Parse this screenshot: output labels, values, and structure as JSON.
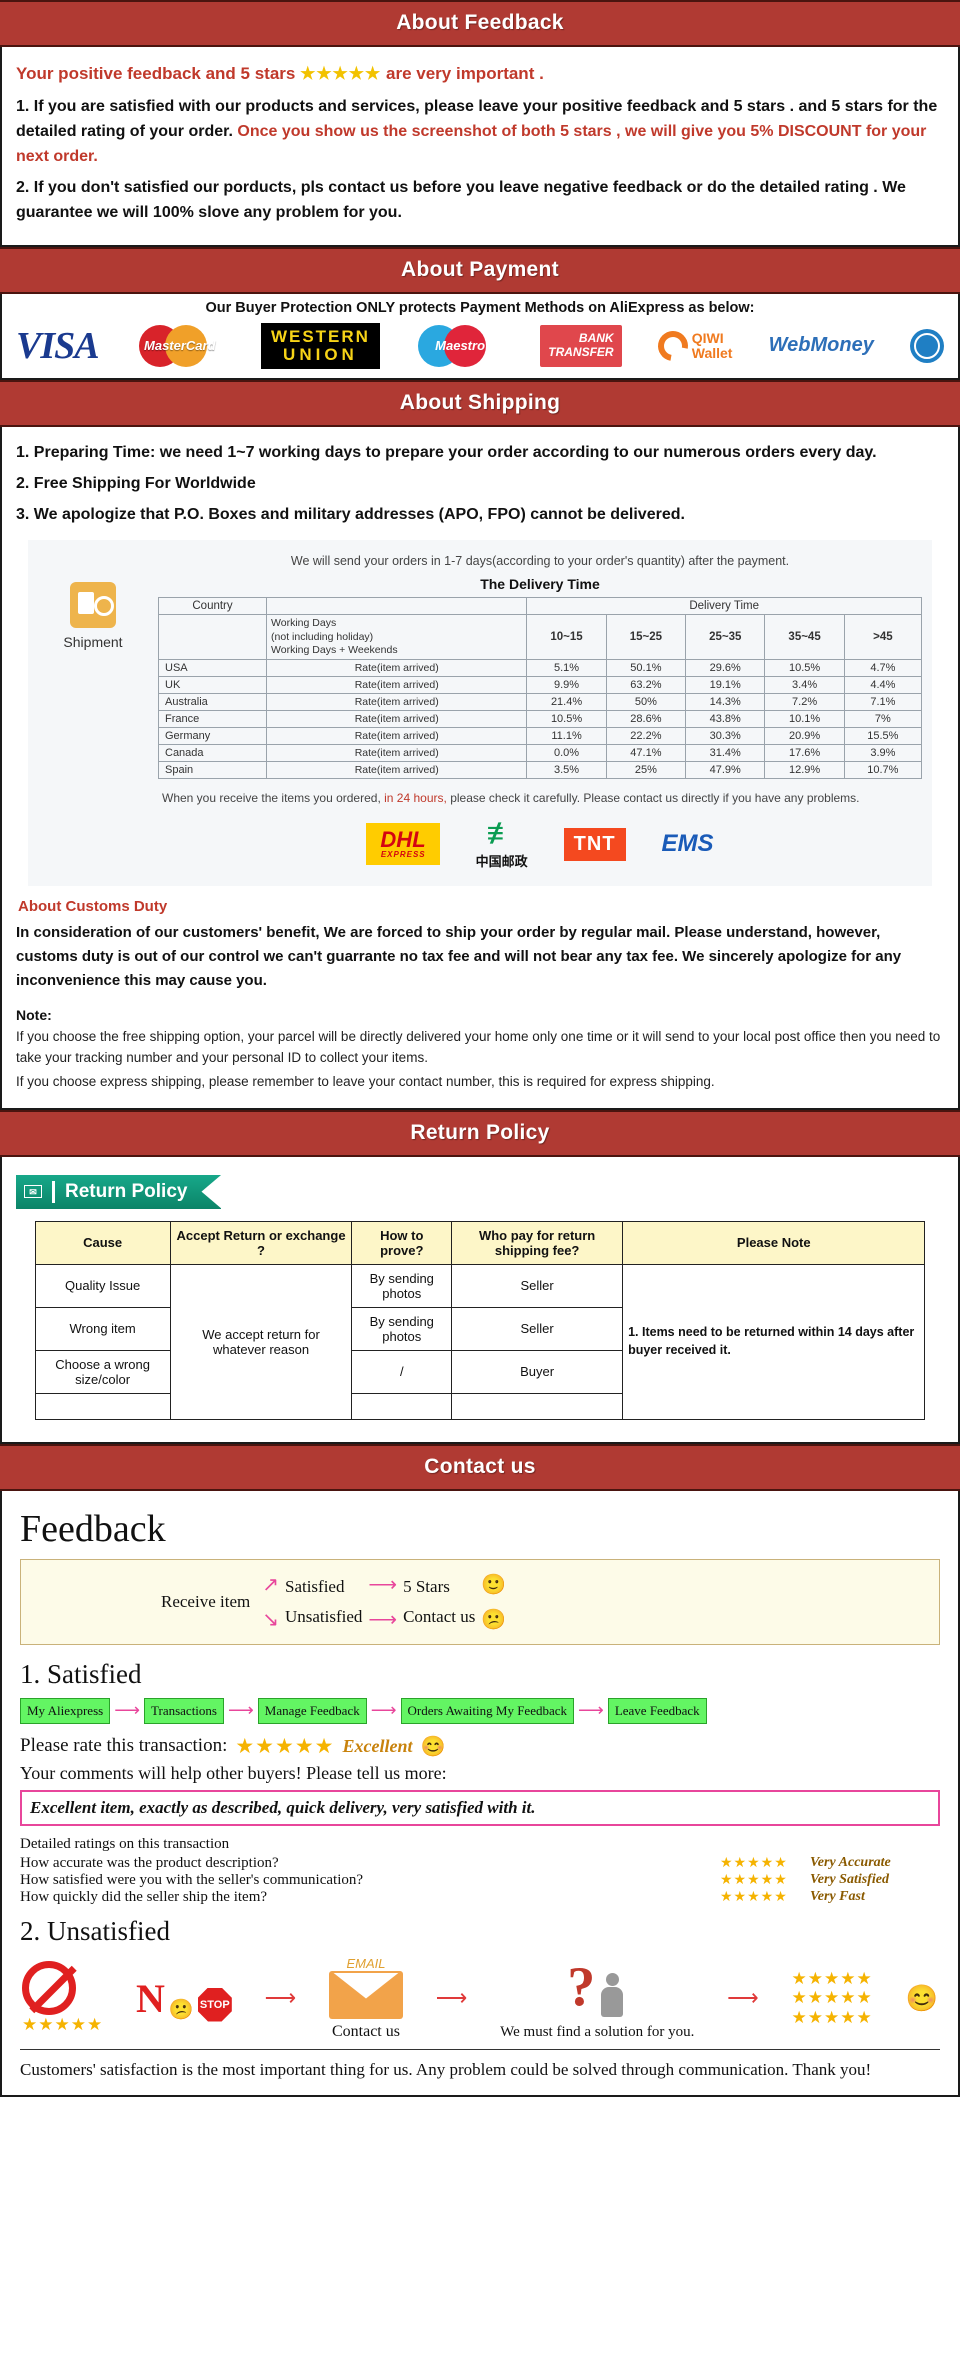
{
  "sections": {
    "feedback": {
      "banner": "About Feedback",
      "lead_before": "Your positive feedback and 5 stars",
      "lead_stars": "★★★★★",
      "lead_after": "are very important .",
      "p1_a": "1. If you are satisfied with our products and services, please leave your positive feedback and 5 stars . and 5 stars for the detailed rating of your order.",
      "p1_b": "Once you show us the screenshot of both 5 stars , we will give you 5% DISCOUNT for your next order.",
      "p2": "2. If you don't satisfied our porducts, pls contact us before you leave negative feedback or do the detailed rating . We guarantee we will 100% slove any problem for you."
    },
    "payment": {
      "banner": "About Payment",
      "note": "Our Buyer Protection ONLY protects Payment Methods on AliExpress as below:",
      "methods": [
        {
          "name": "VISA",
          "id": "visa-logo"
        },
        {
          "name": "MasterCard",
          "id": "mastercard-logo"
        },
        {
          "name": "WESTERN UNION",
          "line1": "WESTERN",
          "line2": "UNION",
          "id": "western-union-logo"
        },
        {
          "name": "Maestro",
          "id": "maestro-logo"
        },
        {
          "name": "BANK TRANSFER",
          "line1": "BANK",
          "line2": "TRANSFER",
          "id": "bank-transfer-logo"
        },
        {
          "name": "QIWI Wallet",
          "line1": "QIWI",
          "line2": "Wallet",
          "id": "qiwi-wallet-logo"
        },
        {
          "name": "WebMoney",
          "id": "webmoney-logo"
        }
      ]
    },
    "shipping": {
      "banner": "About Shipping",
      "items": [
        "1. Preparing Time: we need 1~7 working days to prepare your order according to our numerous orders every day.",
        "2. Free Shipping For Worldwide",
        "3. We apologize that P.O. Boxes and military addresses (APO, FPO) cannot be delivered."
      ],
      "ship_icon_label": "Shipment",
      "card_note": "We will send your orders in 1-7 days(according to your order's quantity) after the payment.",
      "check_note_a": "When you receive the items you ordered,",
      "check_note_red": "in 24 hours,",
      "check_note_b": "please check it carefully. Please contact us directly if you have any problems.",
      "carriers": [
        {
          "name": "DHL",
          "sub": "EXPRESS"
        },
        {
          "name": "China Post",
          "cn": "中国邮政"
        },
        {
          "name": "TNT"
        },
        {
          "name": "EMS"
        }
      ]
    },
    "customs": {
      "heading": "About Customs Duty",
      "body": "In consideration of our customers' benefit, We are forced to ship your order by regular mail. Please understand, however, customs duty is out of our control we can't guarrante no tax fee and will not bear any tax fee. We sincerely apologize for any inconvenience this may cause you.",
      "note_head": "Note:",
      "note1": "If you choose the free shipping option, your parcel will be directly delivered your home only one time or it will send to your local post office then you need to take your tracking number and your personal ID to collect your items.",
      "note2": "If you choose express shipping, please remember to leave your contact number, this is required for express shipping."
    },
    "return": {
      "banner": "Return Policy",
      "tab_label": "Return Policy",
      "note_cell": "1. Items need to be returned within 14 days after buyer received it."
    },
    "contact": {
      "banner": "Contact us",
      "feedback_title": "Feedback",
      "flow": {
        "receive": "Receive item",
        "satisfied": "Satisfied",
        "five_stars": "5 Stars",
        "unsatisfied": "Unsatisfied",
        "contact_us": "Contact us",
        "happy_face": "🙂",
        "sad_face": "😕"
      },
      "satisfied": {
        "heading": "1. Satisfied",
        "steps": [
          "My Aliexpress",
          "Transactions",
          "Manage Feedback",
          "Orders Awaiting My Feedback",
          "Leave Feedback"
        ],
        "rate_label": "Please rate this transaction:",
        "rate_stars": "★★★★★",
        "rate_word": "Excellent",
        "rate_emoji": "😊",
        "comments_prompt": "Your comments will help other buyers! Please tell us more:",
        "comment_text": "Excellent item, exactly as described, quick delivery, very satisfied with it.",
        "detail_head": "Detailed ratings on this transaction",
        "details": [
          {
            "q": "How accurate was the product description?",
            "stars": "★★★★★",
            "value": "Very Accurate"
          },
          {
            "q": "How satisfied were you with the seller's communication?",
            "stars": "★★★★★",
            "value": "Very Satisfied"
          },
          {
            "q": "How quickly did the seller ship the item?",
            "stars": "★★★★★",
            "value": "Very Fast"
          }
        ]
      },
      "unsatisfied": {
        "heading": "2. Unsatisfied",
        "no_label": "N",
        "stop_label": "STOP",
        "email_label": "EMAIL",
        "contact_caption": "Contact us",
        "solution_caption": "We must find a solution for you.",
        "stars_block": "★★★★★",
        "smile": "😊",
        "footer": "Customers' satisfaction is the most important thing for us. Any problem could be solved through communication. Thank you!"
      }
    }
  },
  "chart_data": {
    "type": "table",
    "title": "The Delivery Time",
    "group_header": "Delivery Time",
    "col_country": "Country",
    "col_working": [
      "Working Days",
      "(not including holiday)",
      "Working Days + Weekends"
    ],
    "rate_label": "Rate(item arrived)",
    "categories": [
      "10~15",
      "15~25",
      "25~35",
      "35~45",
      ">45"
    ],
    "rows": [
      {
        "country": "USA",
        "values": [
          "5.1%",
          "50.1%",
          "29.6%",
          "10.5%",
          "4.7%"
        ]
      },
      {
        "country": "UK",
        "values": [
          "9.9%",
          "63.2%",
          "19.1%",
          "3.4%",
          "4.4%"
        ]
      },
      {
        "country": "Australia",
        "values": [
          "21.4%",
          "50%",
          "14.3%",
          "7.2%",
          "7.1%"
        ]
      },
      {
        "country": "France",
        "values": [
          "10.5%",
          "28.6%",
          "43.8%",
          "10.1%",
          "7%"
        ]
      },
      {
        "country": "Germany",
        "values": [
          "11.1%",
          "22.2%",
          "30.3%",
          "20.9%",
          "15.5%"
        ]
      },
      {
        "country": "Canada",
        "values": [
          "0.0%",
          "47.1%",
          "31.4%",
          "17.6%",
          "3.9%"
        ]
      },
      {
        "country": "Spain",
        "values": [
          "3.5%",
          "25%",
          "47.9%",
          "12.9%",
          "10.7%"
        ]
      }
    ]
  },
  "return_table": {
    "headers": [
      "Cause",
      "Accept Return or exchange ?",
      "How to prove?",
      "Who pay for return shipping fee?",
      "Please Note"
    ],
    "rows": [
      {
        "cause": "Quality Issue",
        "prove": "By sending photos",
        "who": "Seller"
      },
      {
        "cause": "Wrong item",
        "prove": "By sending photos",
        "who": "Seller"
      },
      {
        "cause": "Choose a wrong size/color",
        "prove": "/",
        "who": "Buyer"
      }
    ],
    "accept_cell": "We accept return for whatever reason"
  }
}
